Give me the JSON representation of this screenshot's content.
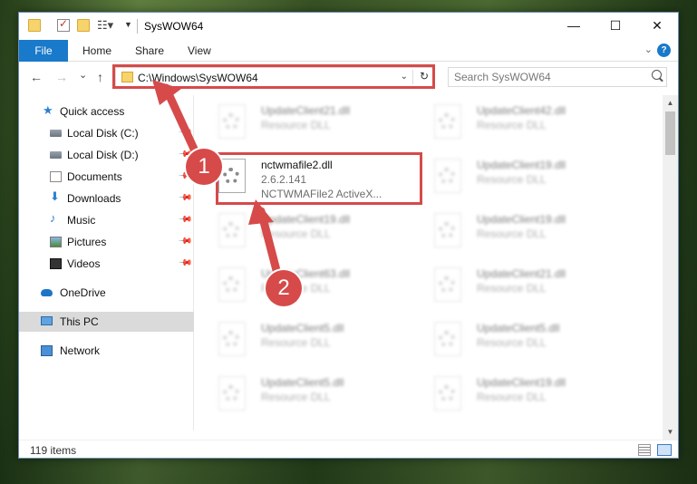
{
  "window": {
    "title": "SysWOW64",
    "controls": {
      "minimize": "—",
      "maximize": "☐",
      "close": "✕"
    }
  },
  "ribbon": {
    "tabs": [
      "File",
      "Home",
      "Share",
      "View"
    ],
    "expand_icon": "chevron-down-icon",
    "help_label": "?"
  },
  "address_bar": {
    "path": "C:\\Windows\\SysWOW64",
    "dropdown": "⌄",
    "refresh": "↻"
  },
  "search": {
    "placeholder": "Search SysWOW64"
  },
  "nav": {
    "back": "←",
    "forward": "→",
    "recent": "⌄",
    "up": "↑"
  },
  "sidebar": {
    "items": [
      {
        "label": "Quick access",
        "icon": "star-icon"
      },
      {
        "label": "Local Disk (C:)",
        "icon": "disk-icon",
        "pinned": true
      },
      {
        "label": "Local Disk (D:)",
        "icon": "disk-icon",
        "pinned": true
      },
      {
        "label": "Documents",
        "icon": "documents-icon",
        "pinned": true
      },
      {
        "label": "Downloads",
        "icon": "download-icon",
        "pinned": true
      },
      {
        "label": "Music",
        "icon": "music-icon",
        "pinned": true
      },
      {
        "label": "Pictures",
        "icon": "pictures-icon",
        "pinned": true
      },
      {
        "label": "Videos",
        "icon": "video-icon",
        "pinned": true
      },
      {
        "label": "OneDrive",
        "icon": "cloud-icon"
      },
      {
        "label": "This PC",
        "icon": "computer-icon",
        "selected": true
      },
      {
        "label": "Network",
        "icon": "network-icon"
      }
    ],
    "pin_glyph": "📌"
  },
  "files": {
    "highlighted": {
      "name": "nctwmafile2.dll",
      "version": "2.6.2.141",
      "description": "NCTWMAFile2 ActiveX..."
    },
    "left_column": [
      {
        "name": "UpdateClient21.dll",
        "type": "Resource DLL"
      },
      {
        "name": "UpdateClient19.dll",
        "type": "Resource DLL"
      },
      {
        "name": "UpdateClient63.dll",
        "type": "Resource DLL"
      },
      {
        "name": "UpdateClient5.dll",
        "type": "Resource DLL"
      },
      {
        "name": "UpdateClient5.dll",
        "type": "Resource DLL"
      }
    ],
    "right_column": [
      {
        "name": "UpdateClient42.dll",
        "type": "Resource DLL"
      },
      {
        "name": "UpdateClient19.dll",
        "type": "Resource DLL"
      },
      {
        "name": "UpdateClient19.dll",
        "type": "Resource DLL"
      },
      {
        "name": "UpdateClient21.dll",
        "type": "Resource DLL"
      },
      {
        "name": "UpdateClient5.dll",
        "type": "Resource DLL"
      },
      {
        "name": "UpdateClient19.dll",
        "type": "Resource DLL"
      }
    ]
  },
  "status": {
    "count": "119 items"
  },
  "annotations": {
    "step1": "1",
    "step2": "2",
    "color": "#d64a4a"
  }
}
